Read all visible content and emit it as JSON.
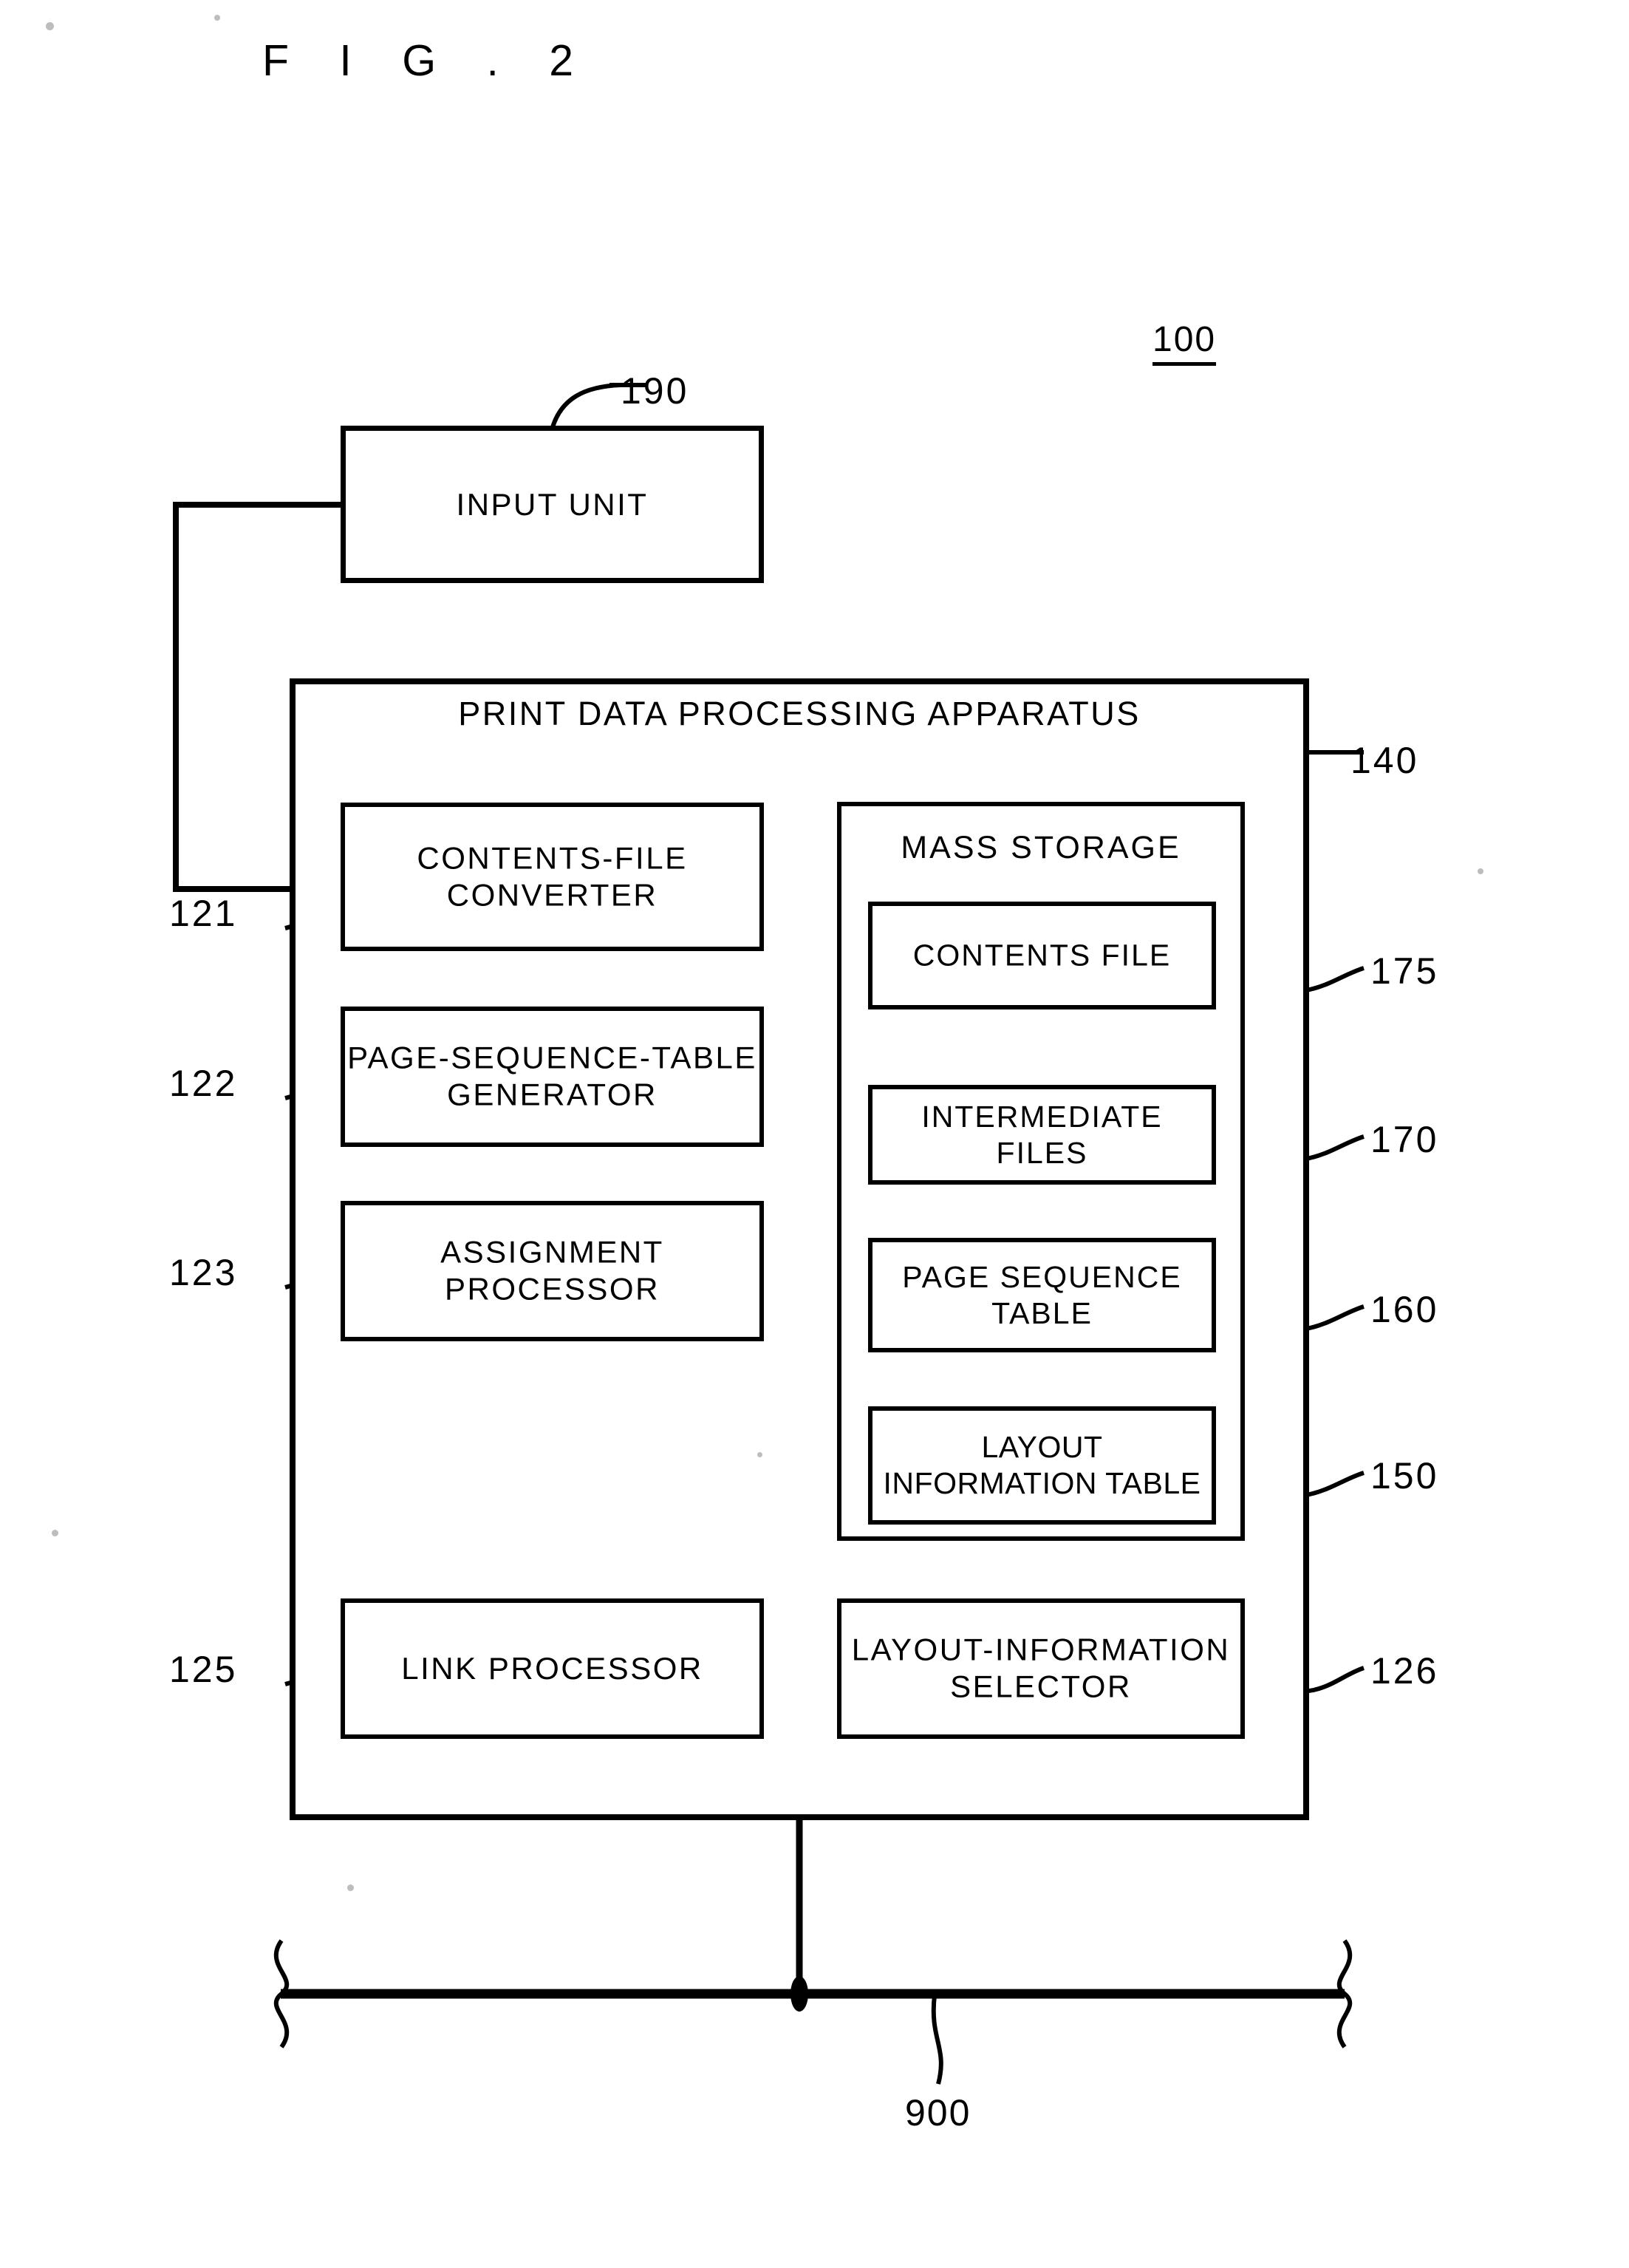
{
  "figure": {
    "title": "F I G .  2",
    "system_ref": "100"
  },
  "input_unit": {
    "label": "INPUT UNIT",
    "ref": "190"
  },
  "apparatus": {
    "title": "PRINT DATA PROCESSING APPARATUS",
    "modules": [
      {
        "label": "CONTENTS-FILE\nCONVERTER",
        "ref": "121"
      },
      {
        "label": "PAGE-SEQUENCE-TABLE\nGENERATOR",
        "ref": "122"
      },
      {
        "label": "ASSIGNMENT PROCESSOR",
        "ref": "123"
      },
      {
        "label": "LINK PROCESSOR",
        "ref": "125"
      },
      {
        "label": "LAYOUT-INFORMATION\nSELECTOR",
        "ref": "126"
      }
    ]
  },
  "mass_storage": {
    "title": "MASS STORAGE",
    "ref": "140",
    "items": [
      {
        "label": "CONTENTS FILE",
        "ref": "175"
      },
      {
        "label": "INTERMEDIATE FILES",
        "ref": "170"
      },
      {
        "label": "PAGE SEQUENCE\nTABLE",
        "ref": "160"
      },
      {
        "label": "LAYOUT\nINFORMATION TABLE",
        "ref": "150"
      }
    ]
  },
  "bus": {
    "ref": "900"
  },
  "colors": {
    "ink": "#000000",
    "paper": "#ffffff"
  }
}
